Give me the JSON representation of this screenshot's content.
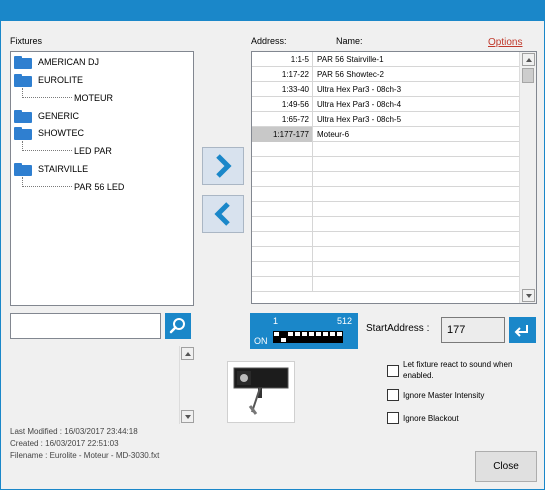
{
  "labels": {
    "fixtures": "Fixtures",
    "address": "Address:",
    "name": "Name:",
    "options": "Options",
    "start_address": "StartAddress :"
  },
  "tree": [
    {
      "label": "AMERICAN DJ",
      "children": []
    },
    {
      "label": "EUROLITE",
      "children": [
        "MOTEUR"
      ]
    },
    {
      "label": "GENERIC",
      "children": []
    },
    {
      "label": "SHOWTEC",
      "children": [
        "LED PAR"
      ]
    },
    {
      "label": "STAIRVILLE",
      "children": [
        "PAR 56 LED"
      ]
    }
  ],
  "search": {
    "value": "",
    "placeholder": ""
  },
  "patch": [
    {
      "address": "1:1-5",
      "name": "PAR 56 Stairville-1"
    },
    {
      "address": "1:17-22",
      "name": "PAR 56 Showtec-2"
    },
    {
      "address": "1:33-40",
      "name": "Ultra Hex Par3 - 08ch-3"
    },
    {
      "address": "1:49-56",
      "name": "Ultra Hex Par3 - 08ch-4"
    },
    {
      "address": "1:65-72",
      "name": "Ultra Hex Par3 - 08ch-5"
    },
    {
      "address": "1:177-177",
      "name": "Moteur-6"
    }
  ],
  "selected_row": 5,
  "dip": {
    "low": "1",
    "high": "512",
    "on": "ON"
  },
  "start_address": {
    "value": "177"
  },
  "checkboxes": [
    {
      "label": "Let fixture react to sound when enabled.",
      "checked": false
    },
    {
      "label": "Ignore Master Intensity",
      "checked": false
    },
    {
      "label": "Ignore Blackout",
      "checked": false
    }
  ],
  "info": {
    "modified": "Last Modified : 16/03/2017 23:44:18",
    "created": "Created : 16/03/2017 22:51:03",
    "filename": "Filename : Eurolite - Moteur - MD-3030.fxt"
  },
  "close_label": "Close",
  "icons": [
    "folder-icon",
    "search-icon",
    "arrow-right-icon",
    "arrow-left-icon",
    "enter-icon",
    "scroll-up-icon",
    "scroll-down-icon"
  ],
  "colors": {
    "accent": "#1a87c9",
    "options_link": "#c0392b",
    "folder": "#2f7fd0"
  }
}
